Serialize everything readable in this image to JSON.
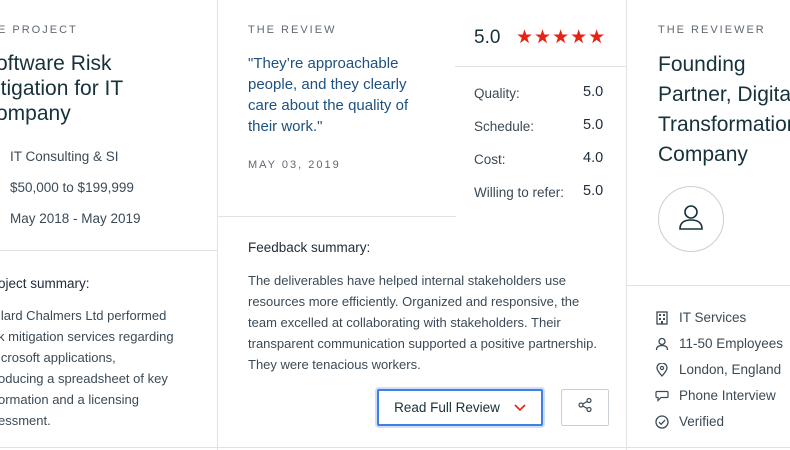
{
  "project": {
    "kicker": "E PROJECT",
    "title_lines": [
      "oftware Risk",
      "itigation for IT",
      "ompany"
    ],
    "category": "IT Consulting & SI",
    "budget": "$50,000 to $199,999",
    "dates": "May 2018 - May 2019",
    "summary_heading": "oject summary:",
    "summary_lines": [
      "llard Chalmers Ltd performed",
      "k mitigation services regarding",
      "icrosoft applications,",
      "oducing a spreadsheet of key",
      "ormation and a licensing",
      "essment."
    ]
  },
  "review": {
    "kicker": "THE REVIEW",
    "quote": "\"They’re approachable people, and they clearly care about the quality of their work.\"",
    "date": "MAY 03, 2019",
    "overall_score": "5.0",
    "stars": "★★★★★",
    "ratings": [
      {
        "label": "Quality:",
        "value": "5.0"
      },
      {
        "label": "Schedule:",
        "value": "5.0"
      },
      {
        "label": "Cost:",
        "value": "4.0"
      },
      {
        "label": "Willing to refer:",
        "value": "5.0"
      }
    ],
    "feedback_heading": "Feedback summary:",
    "feedback_text": "The deliverables have helped internal stakeholders use resources more efficiently. Organized and responsive, the team excelled at collaborating with stakeholders. Their transparent communication supported a positive partnership. They were tenacious workers.",
    "read_button_label": "Read Full Review",
    "accent_color": "#e62415",
    "button_border_color": "#3f7fe6"
  },
  "reviewer": {
    "kicker": "THE REVIEWER",
    "title_lines": [
      "Founding",
      "Partner, Digita",
      "Transformation",
      "Company"
    ],
    "details": [
      {
        "icon": "building-icon",
        "text": "IT Services"
      },
      {
        "icon": "person-icon",
        "text": "11-50 Employees"
      },
      {
        "icon": "location-pin-icon",
        "text": "London, England"
      },
      {
        "icon": "chat-bubble-icon",
        "text": "Phone Interview"
      },
      {
        "icon": "check-circle-icon",
        "text": "Verified"
      }
    ]
  }
}
